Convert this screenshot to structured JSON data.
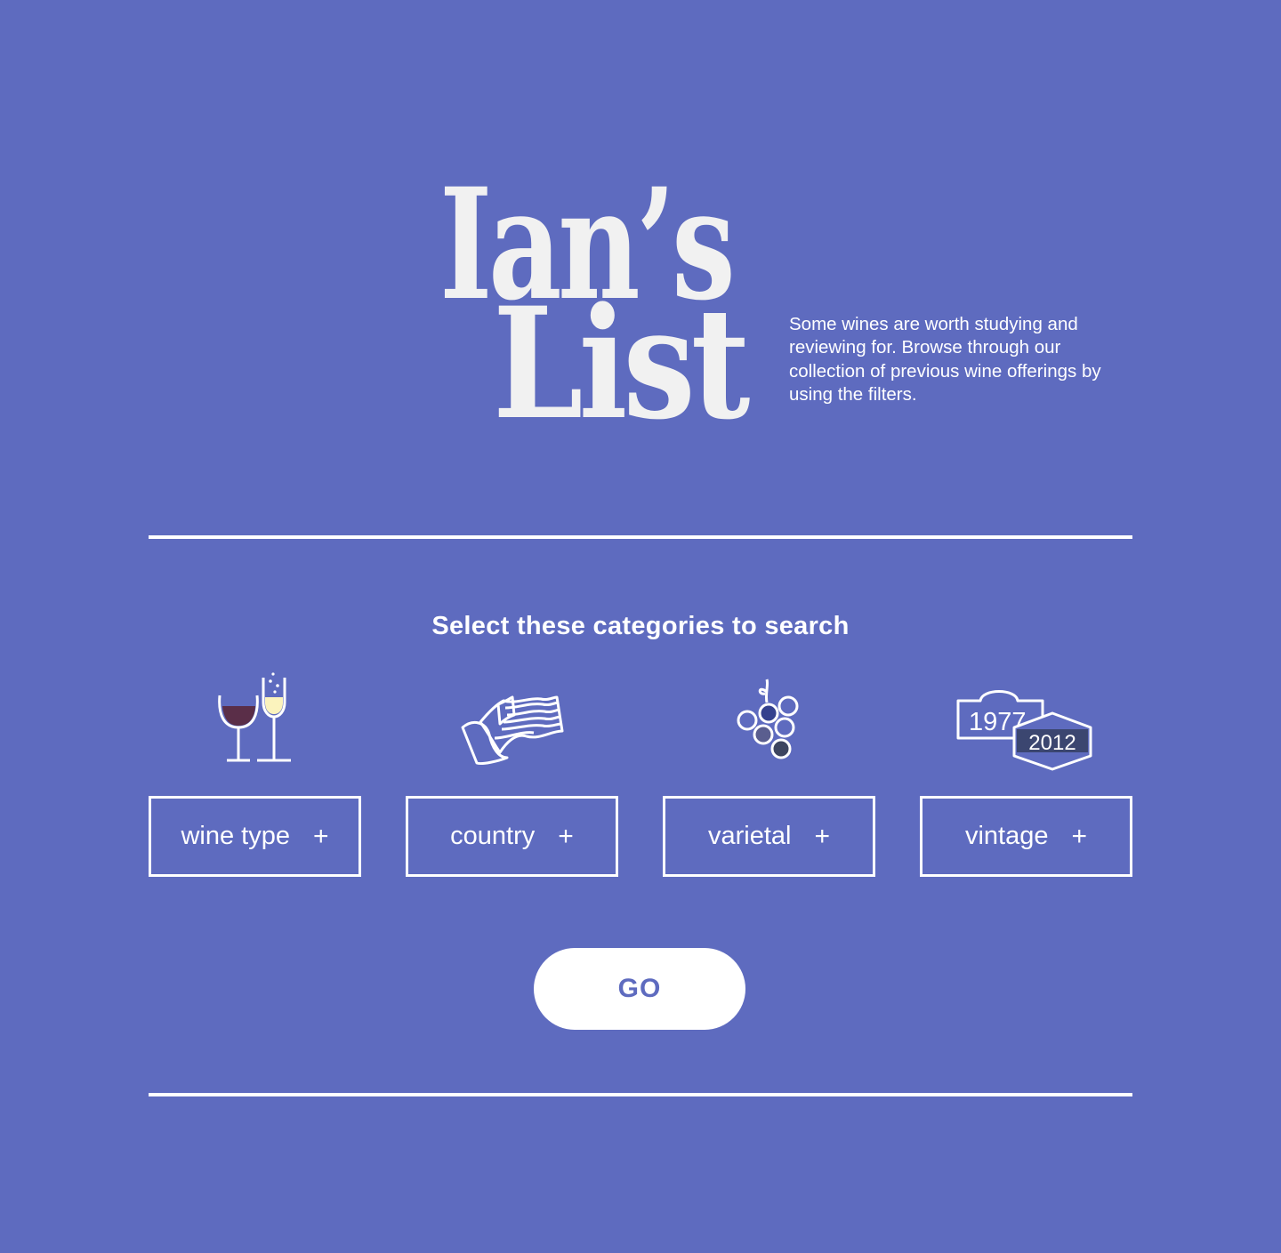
{
  "colors": {
    "background": "#5e6bbf",
    "foreground": "#ffffff",
    "logo": "#f1f1f1",
    "red_wine": "#5a2e48",
    "white_wine": "#fbf3bd",
    "grape_dark": "#34418e",
    "grape_mid": "#5a5e8f",
    "grape_deep": "#3d4560",
    "vintage_badge": "#3b4670"
  },
  "header": {
    "title_line1": "Ian’s",
    "title_line2": "List",
    "tagline": "Some wines are worth studying and reviewing for. Browse through our collection of previous wine offerings by using the filters."
  },
  "search": {
    "prompt": "Select these categories to search",
    "categories": [
      {
        "icon": "wine-glasses-icon",
        "label": "wine type",
        "action": "+"
      },
      {
        "icon": "flag-icon",
        "label": "country",
        "action": "+"
      },
      {
        "icon": "grapes-icon",
        "label": "varietal",
        "action": "+"
      },
      {
        "icon": "vintage-years-icon",
        "label": "vintage",
        "action": "+"
      }
    ],
    "vintage_icon": {
      "year_old": "1977",
      "year_new": "2012"
    },
    "go_label": "GO"
  }
}
